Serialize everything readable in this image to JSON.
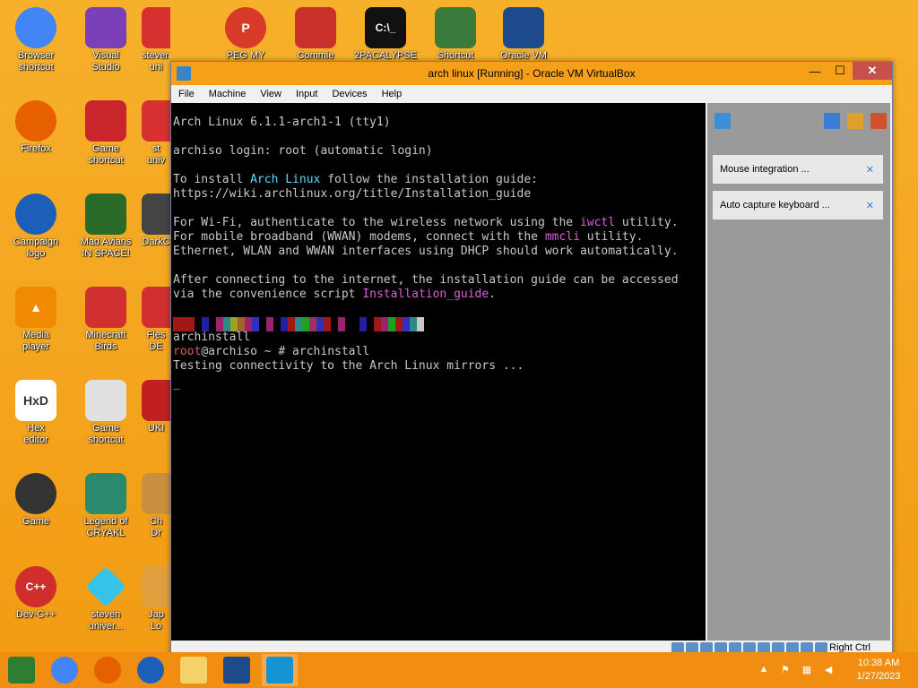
{
  "desktop": {
    "col1": [
      {
        "label": "Browser\nshortcut",
        "icon": "chrome-icon",
        "color": "#4285f4"
      },
      {
        "label": "Firefox",
        "icon": "firefox-icon",
        "color": "#e66000"
      },
      {
        "label": "Campaign\nlogo",
        "icon": "campaign-logo-icon",
        "color": "#1b5fb8"
      },
      {
        "label": "Media\nplayer",
        "icon": "vlc-icon",
        "color": "#f08a00"
      },
      {
        "label": "Hex\neditor",
        "icon": "hxd-icon",
        "color": "#ffffff"
      },
      {
        "label": "Game",
        "icon": "game-icon",
        "color": "#333333"
      },
      {
        "label": "Dev-C++",
        "icon": "devcpp-icon",
        "color": "#d12d2d"
      }
    ],
    "col2": [
      {
        "label": "Visual\nStudio",
        "icon": "visual-studio-icon",
        "color": "#7b3fb8"
      },
      {
        "label": "Game\nshortcut",
        "icon": "game-seasons-icon",
        "color": "#c9252c"
      },
      {
        "label": "Mad Avians\nIN SPACE!",
        "icon": "game-space-icon",
        "color": "#2a6b2a"
      },
      {
        "label": "Minecraft\nBirds",
        "icon": "game-birds-icon",
        "color": "#d03030"
      },
      {
        "label": "Game\nshortcut",
        "icon": "pixel-game-icon",
        "color": "#e0e0e0"
      },
      {
        "label": "Legend of\nCRYAKL",
        "icon": "legend-icon",
        "color": "#2b8a6e"
      },
      {
        "label": "steven\nuniver...",
        "icon": "diamond-icon",
        "color": "#35c4e8"
      }
    ],
    "col3_partial": [
      "steven\nuni",
      "st\nuniv",
      "DarkC",
      "Fles\nDE",
      "UKI",
      "Ch\nDr",
      "Jap\nLo"
    ],
    "top_row": [
      {
        "label": "PEG MY WIFE!",
        "icon": "peg-icon",
        "color": "#d83a2a"
      },
      {
        "label": "Commie",
        "icon": "commie-icon",
        "color": "#c8302a"
      },
      {
        "label": "2PACALYPSE",
        "icon": "cmd-icon",
        "color": "#111111"
      },
      {
        "label": "Shortcut",
        "icon": "santa-icon",
        "color": "#3a7a3a"
      },
      {
        "label": "Oracle VM",
        "icon": "virtualbox-icon",
        "color": "#1c4a8a"
      }
    ]
  },
  "vbox": {
    "title": "arch linux [Running] - Oracle VM VirtualBox",
    "min": "—",
    "max": "☐",
    "close": "✕",
    "menu": [
      "File",
      "Machine",
      "View",
      "Input",
      "Devices",
      "Help"
    ],
    "notices": [
      "Mouse integration ...",
      "Auto capture keyboard ..."
    ],
    "right_ctrl": "Right Ctrl"
  },
  "terminal": {
    "l1": "Arch Linux 6.1.1-arch1-1 (tty1)",
    "l2": "archiso login: root (automatic login)",
    "l3a": "To install ",
    "l3b": "Arch Linux",
    "l3c": " follow the installation guide:",
    "l4": "https://wiki.archlinux.org/title/Installation_guide",
    "l5a": "For Wi-Fi, authenticate to the wireless network using the ",
    "l5b": "iwctl",
    "l5c": " utility.",
    "l6a": "For mobile broadband (WWAN) modems, connect with the ",
    "l6b": "mmcli",
    "l6c": " utility.",
    "l7": "Ethernet, WLAN and WWAN interfaces using DHCP should work automatically.",
    "l8": "After connecting to the internet, the installation guide can be accessed",
    "l9a": "via the convenience script ",
    "l9b": "Installation_guide",
    "l9c": ".",
    "l10": "archinstall",
    "l11a": "root",
    "l11b": "@archiso ~ # archinstall",
    "l12": "Testing connectivity to the Arch Linux mirrors ...",
    "l13": "_"
  },
  "taskbar": {
    "time": "10:38 AM",
    "date": "1/27/2023"
  }
}
